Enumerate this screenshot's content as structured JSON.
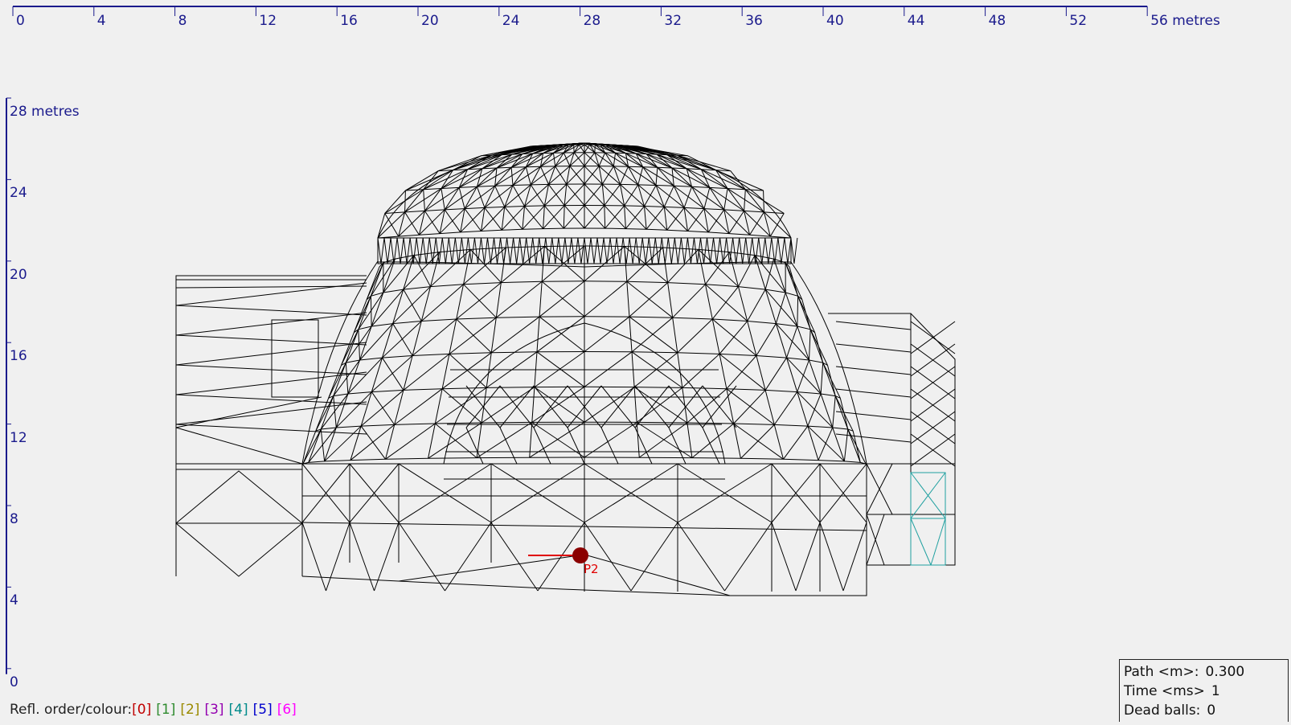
{
  "axes": {
    "x_ticks": [
      "0",
      "4",
      "8",
      "12",
      "16",
      "20",
      "24",
      "28",
      "32",
      "36",
      "40",
      "44",
      "48",
      "52",
      "56 metres"
    ],
    "y_ticks": [
      "28 metres",
      "24",
      "20",
      "16",
      "12",
      "8",
      "4",
      "0"
    ],
    "axis_color": "#1a1a8c"
  },
  "source": {
    "label": "P2",
    "color": "#8b0000",
    "ray_color": "#e00000"
  },
  "legend": {
    "label": "Refl. order/colour:",
    "items": [
      {
        "text": "[0]",
        "color": "#c00000"
      },
      {
        "text": "[1]",
        "color": "#2e8b2e"
      },
      {
        "text": "[2]",
        "color": "#9a8a00"
      },
      {
        "text": "[3]",
        "color": "#9400b0"
      },
      {
        "text": "[4]",
        "color": "#008b8b"
      },
      {
        "text": "[5]",
        "color": "#0000cc"
      },
      {
        "text": "[6]",
        "color": "#ff00ff"
      }
    ]
  },
  "status": {
    "path_label": "Path <m>:",
    "path_value": "0.300",
    "time_label": "Time <ms>",
    "time_value": "1",
    "dead_label": "Dead balls:",
    "dead_value": "0"
  }
}
